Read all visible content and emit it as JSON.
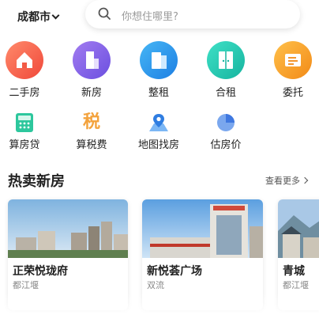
{
  "header": {
    "city": "成都市",
    "search_placeholder": "你想住哪里?"
  },
  "main_nav": [
    {
      "label": "二手房",
      "icon": "house-icon"
    },
    {
      "label": "新房",
      "icon": "building-icon"
    },
    {
      "label": "整租",
      "icon": "apartment-icon"
    },
    {
      "label": "合租",
      "icon": "door-icon"
    },
    {
      "label": "委托",
      "icon": "entrust-icon"
    }
  ],
  "tools_nav": [
    {
      "label": "算房贷",
      "icon": "calculator-icon"
    },
    {
      "label": "算税费",
      "icon": "tax-icon",
      "glyph": "税"
    },
    {
      "label": "地图找房",
      "icon": "map-pin-icon"
    },
    {
      "label": "估房价",
      "icon": "pie-chart-icon"
    }
  ],
  "hot_section": {
    "title": "热卖新房",
    "more": "查看更多"
  },
  "cards": [
    {
      "name": "正荣悦珑府",
      "area": "都江堰"
    },
    {
      "name": "新悦荟广场",
      "area": "双流"
    },
    {
      "name": "青城",
      "area": "都江堰"
    }
  ]
}
